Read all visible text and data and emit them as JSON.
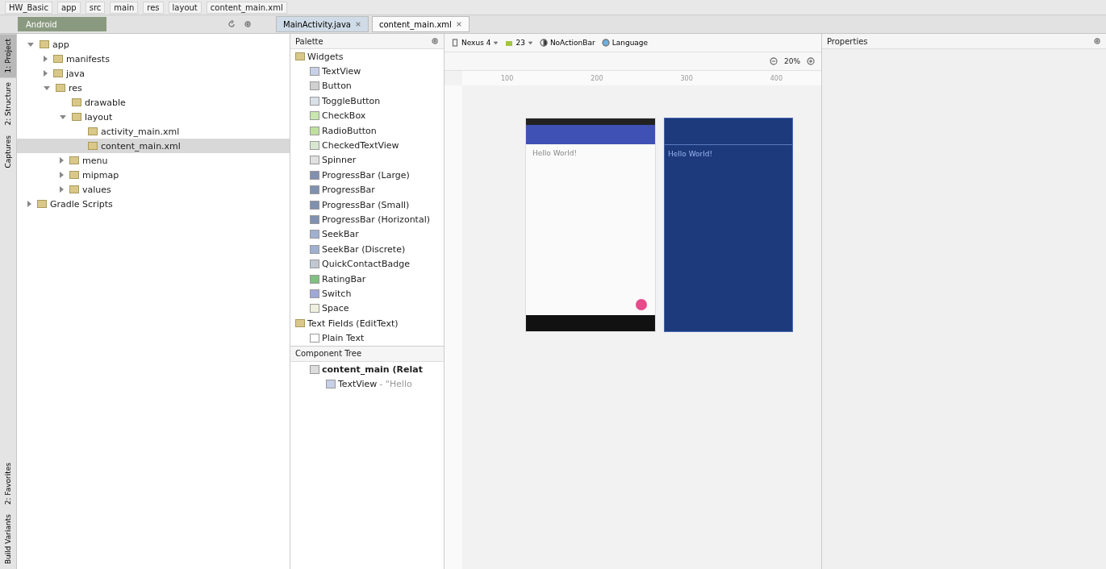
{
  "breadcrumbs": [
    "HW_Basic",
    "app",
    "src",
    "main",
    "res",
    "layout",
    "content_main.xml"
  ],
  "editor_tabs": [
    {
      "label": "MainActivity.java",
      "selected": false
    },
    {
      "label": "content_main.xml",
      "selected": true
    }
  ],
  "side_tabs_top": [
    {
      "label": "1: Project",
      "selected": true
    },
    {
      "label": "2: Structure",
      "selected": false
    },
    {
      "label": "Captures",
      "selected": false
    }
  ],
  "side_tabs_bottom": [
    {
      "label": "2: Favorites",
      "selected": false
    },
    {
      "label": "Build Variants",
      "selected": false
    }
  ],
  "project_view": "Android",
  "project_tree": [
    {
      "label": "app",
      "expanded": true,
      "selected": false,
      "children": [
        {
          "label": "manifests",
          "expanded": false,
          "selected": false
        },
        {
          "label": "java",
          "expanded": false,
          "selected": false
        },
        {
          "label": "res",
          "expanded": true,
          "selected": false,
          "children": [
            {
              "label": "drawable",
              "selected": false
            },
            {
              "label": "layout",
              "expanded": true,
              "selected": false,
              "children": [
                {
                  "label": "activity_main.xml",
                  "selected": false
                },
                {
                  "label": "content_main.xml",
                  "selected": true
                }
              ]
            },
            {
              "label": "menu",
              "expanded": false,
              "selected": false
            },
            {
              "label": "mipmap",
              "expanded": false,
              "selected": false
            },
            {
              "label": "values",
              "expanded": false,
              "selected": false
            }
          ]
        }
      ]
    },
    {
      "label": "Gradle Scripts",
      "expanded": false,
      "selected": false
    }
  ],
  "palette": {
    "title": "Palette",
    "groups": [
      {
        "label": "Widgets",
        "items": [
          "TextView",
          "Button",
          "ToggleButton",
          "CheckBox",
          "RadioButton",
          "CheckedTextView",
          "Spinner",
          "ProgressBar (Large)",
          "ProgressBar",
          "ProgressBar (Small)",
          "ProgressBar (Horizontal)",
          "SeekBar",
          "SeekBar (Discrete)",
          "QuickContactBadge",
          "RatingBar",
          "Switch",
          "Space"
        ]
      },
      {
        "label": "Text Fields (EditText)",
        "items": [
          "Plain Text"
        ]
      }
    ]
  },
  "component_tree": {
    "title": "Component Tree",
    "root": "content_main (Relat",
    "child": "TextView",
    "child_hint": "- \"Hello"
  },
  "design_toolbar": {
    "device": "Nexus 4",
    "api": "23",
    "theme": "NoActionBar",
    "language": "Language",
    "zoom": "20%"
  },
  "ruler": [
    "100",
    "200",
    "300",
    "400"
  ],
  "preview": {
    "text": "Hello World!",
    "blueprint_text": "Hello World!"
  },
  "properties": {
    "title": "Properties"
  }
}
